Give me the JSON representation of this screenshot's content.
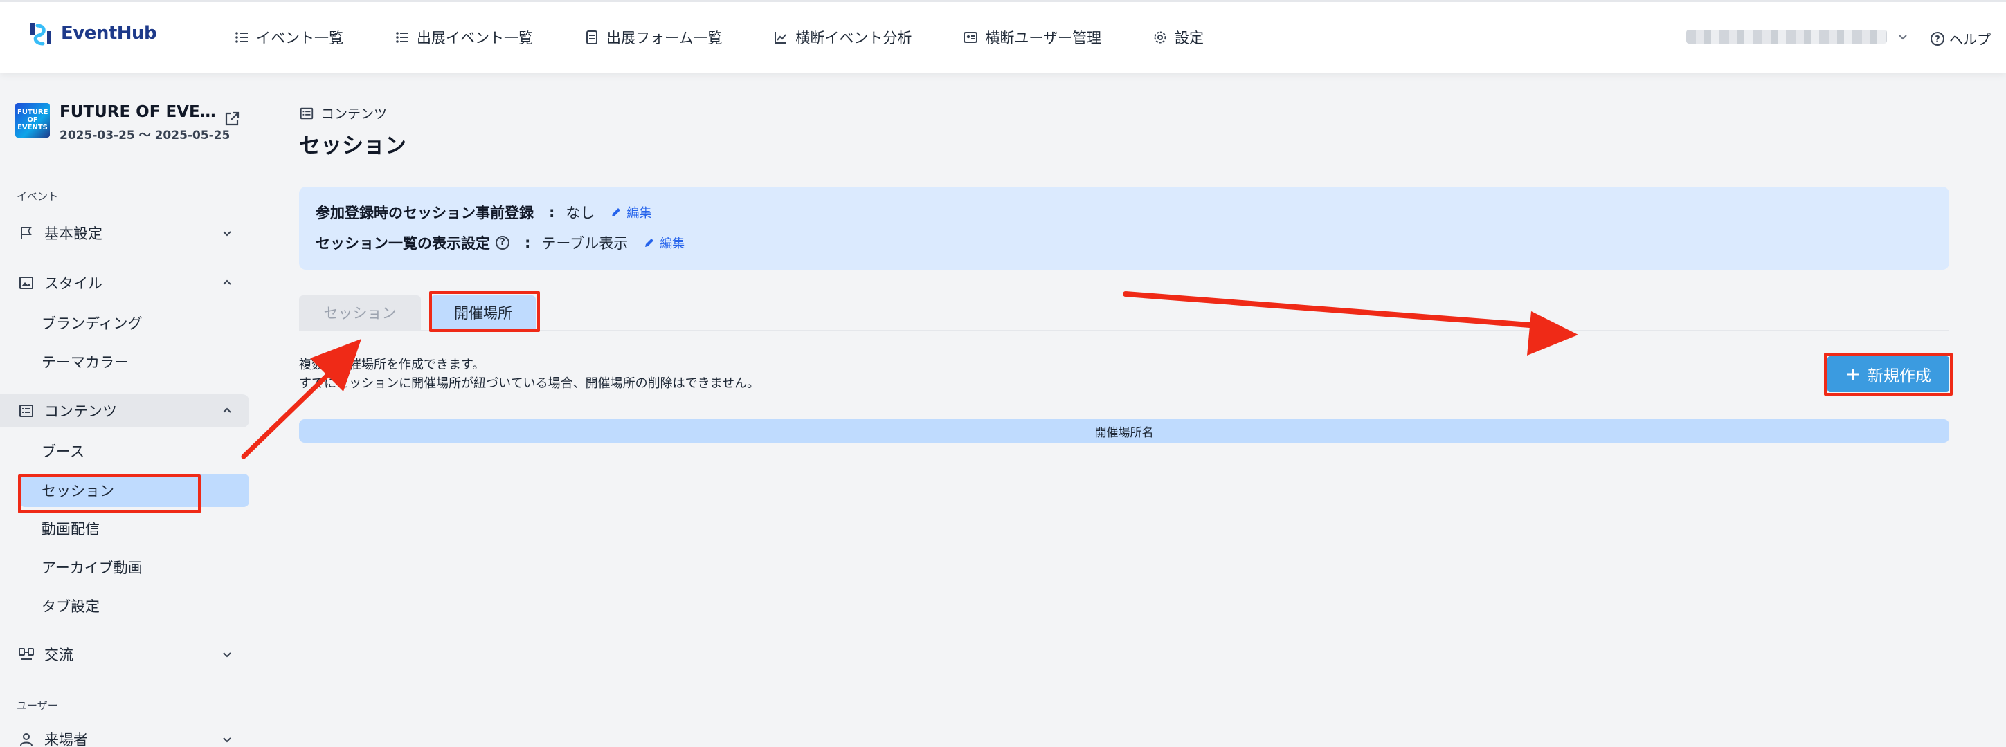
{
  "header": {
    "brand": "EventHub",
    "nav": [
      {
        "label": "イベント一覧",
        "icon": "list-icon"
      },
      {
        "label": "出展イベント一覧",
        "icon": "list-icon"
      },
      {
        "label": "出展フォーム一覧",
        "icon": "form-icon"
      },
      {
        "label": "横断イベント分析",
        "icon": "chart-line-icon"
      },
      {
        "label": "横断ユーザー管理",
        "icon": "id-card-icon"
      },
      {
        "label": "設定",
        "icon": "gear-icon"
      }
    ],
    "help": "ヘルプ"
  },
  "sidebar": {
    "event": {
      "title": "FUTURE OF EVEN…",
      "thumb_text": "FUTURE OF EVENTS",
      "dates": "2025-03-25 〜 2025-05-25"
    },
    "sections": {
      "event": "イベント",
      "user": "ユーザー"
    },
    "items": {
      "basic": "基本設定",
      "style": "スタイル",
      "branding": "ブランディング",
      "theme_color": "テーマカラー",
      "contents": "コンテンツ",
      "booth": "ブース",
      "session": "セッション",
      "video": "動画配信",
      "archive": "アーカイブ動画",
      "tabs": "タブ設定",
      "exchange": "交流",
      "visitors": "来場者"
    }
  },
  "main": {
    "breadcrumb": "コンテンツ",
    "title": "セッション",
    "info": {
      "pre_registration_key": "参加登録時のセッション事前登録",
      "pre_registration_value": "なし",
      "display_key": "セッション一覧の表示設定",
      "display_value": "テーブル表示",
      "colon": ":",
      "edit": "編集",
      "help_mark": "?"
    },
    "tabs": {
      "session": "セッション",
      "venue": "開催場所"
    },
    "description": {
      "line1": "複数の開催場所を作成できます。",
      "line2": "すでにセッションに開催場所が紐づいている場合、開催場所の削除はできません。"
    },
    "new_button": "新規作成",
    "table_header": "開催場所名"
  },
  "colors": {
    "accent_blue": "#3b9be0",
    "highlight_red": "#ef2a17",
    "tab_active": "#bfdbfe",
    "info_bg": "#dbeafe"
  }
}
